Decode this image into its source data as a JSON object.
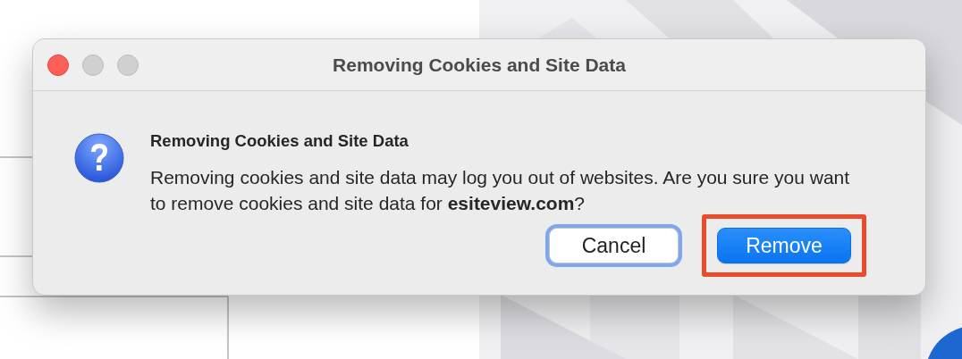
{
  "window": {
    "title": "Removing Cookies and Site Data",
    "controls": [
      {
        "kind": "close",
        "enabled": true
      },
      {
        "kind": "minimize",
        "enabled": false
      },
      {
        "kind": "zoom",
        "enabled": false
      }
    ]
  },
  "dialog": {
    "heading": "Removing Cookies and Site Data",
    "message": "Removing cookies and site data may log you out of websites. Are you sure you want to remove cookies and site data for **esiteview.com**?"
  },
  "buttons": [
    {
      "label": "Cancel",
      "kind": "plain",
      "focused": true,
      "highlighted": false
    },
    {
      "label": "Remove",
      "kind": "default",
      "focused": false,
      "highlighted": true
    }
  ]
}
